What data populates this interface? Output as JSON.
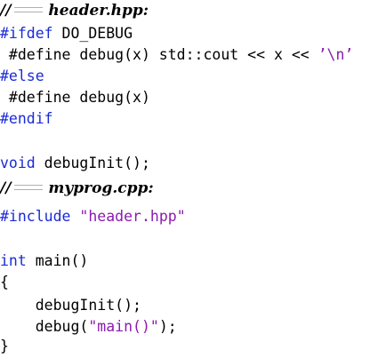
{
  "header_file": {
    "comment": "//",
    "filename": "header.hpp:"
  },
  "lines_a": {
    "l1_kw": "#ifdef",
    "l1_rest": " DO_DEBUG",
    "l2_code": " #define debug(x) std::cout << x << ",
    "l2_str": "’\\n’",
    "l3_kw": "#else",
    "l4_code": " #define debug(x)",
    "l5_kw": "#endif",
    "l7_kw": "void",
    "l7_rest": " debugInit();"
  },
  "source_file": {
    "comment": "//",
    "filename": "myprog.cpp:"
  },
  "lines_b": {
    "l1_kw": "#include",
    "l1_sp": " ",
    "l1_str": "\"header.hpp\"",
    "l3_kw": "int",
    "l3_rest": " main()",
    "l4": "{",
    "l5": "    debugInit();",
    "l6_code": "    debug(",
    "l6_str": "\"main()\"",
    "l6_end": ");",
    "l7": "}"
  }
}
